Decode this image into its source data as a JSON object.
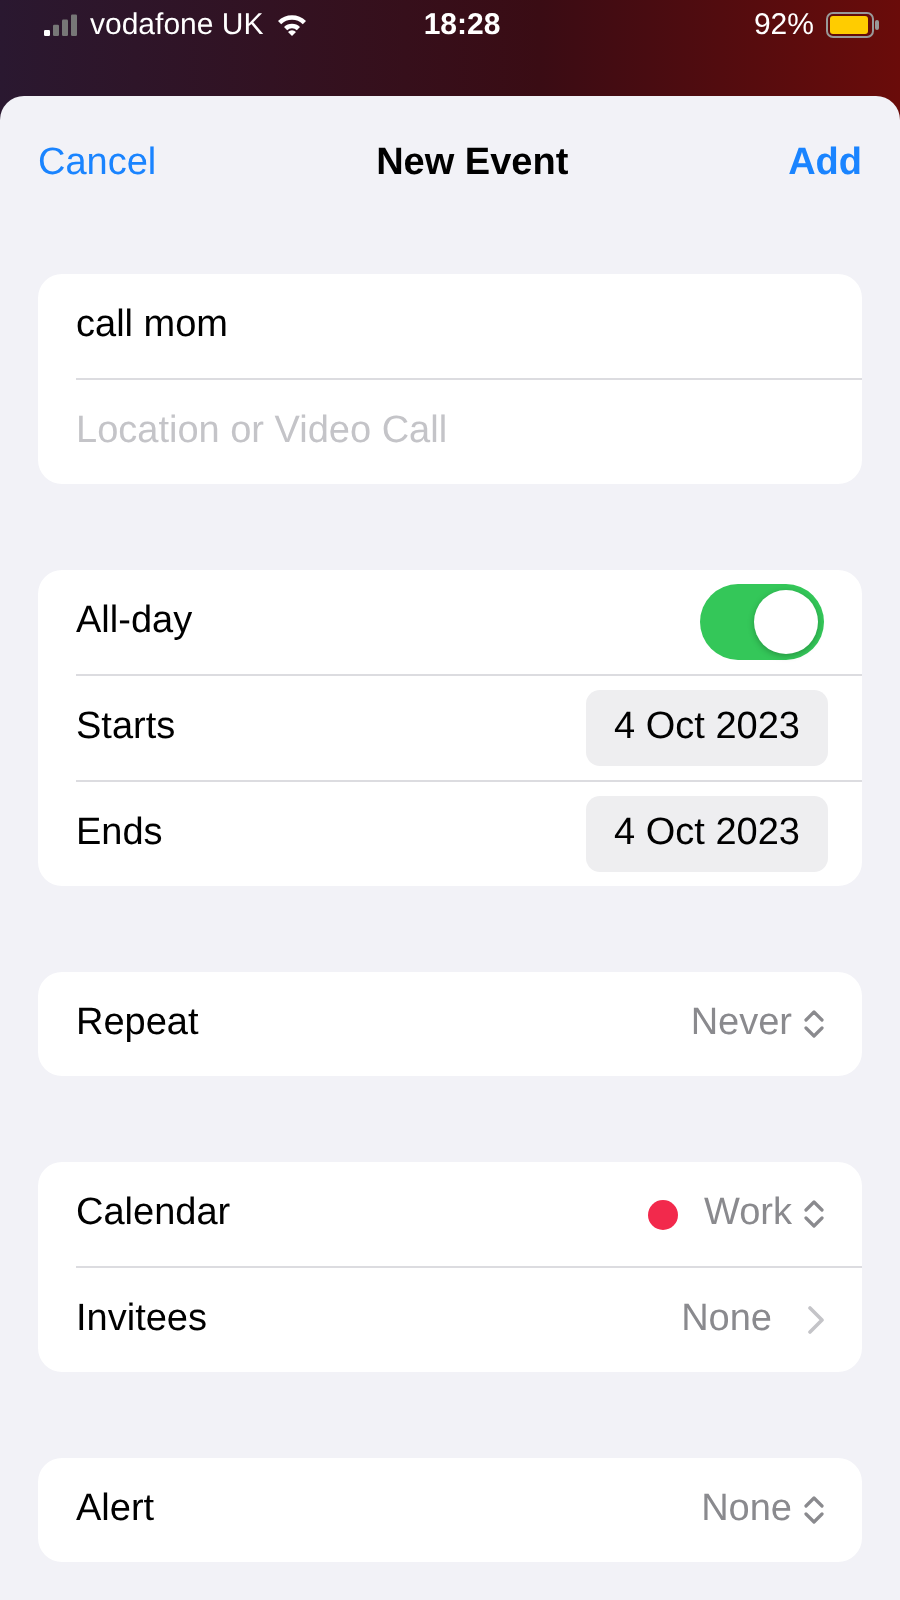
{
  "status_bar": {
    "carrier": "vodafone UK",
    "time": "18:28",
    "battery": "92%"
  },
  "nav": {
    "cancel": "Cancel",
    "title": "New Event",
    "add": "Add"
  },
  "fields": [
    {
      "value": "call mom"
    },
    {
      "placeholder": "Location or Video Call"
    }
  ],
  "groups": [
    [
      {
        "kind": "toggle",
        "label": "All-day",
        "on": true
      },
      {
        "kind": "date",
        "label": "Starts",
        "value": "4 Oct 2023"
      },
      {
        "kind": "date",
        "label": "Ends",
        "value": "4 Oct 2023"
      }
    ],
    [
      {
        "kind": "picker",
        "label": "Repeat",
        "value": "Never"
      }
    ],
    [
      {
        "kind": "picker",
        "label": "Calendar",
        "value": "Work",
        "color": "#f2294c"
      },
      {
        "kind": "link",
        "label": "Invitees",
        "value": "None"
      }
    ],
    [
      {
        "kind": "picker",
        "label": "Alert",
        "value": "None"
      }
    ]
  ]
}
